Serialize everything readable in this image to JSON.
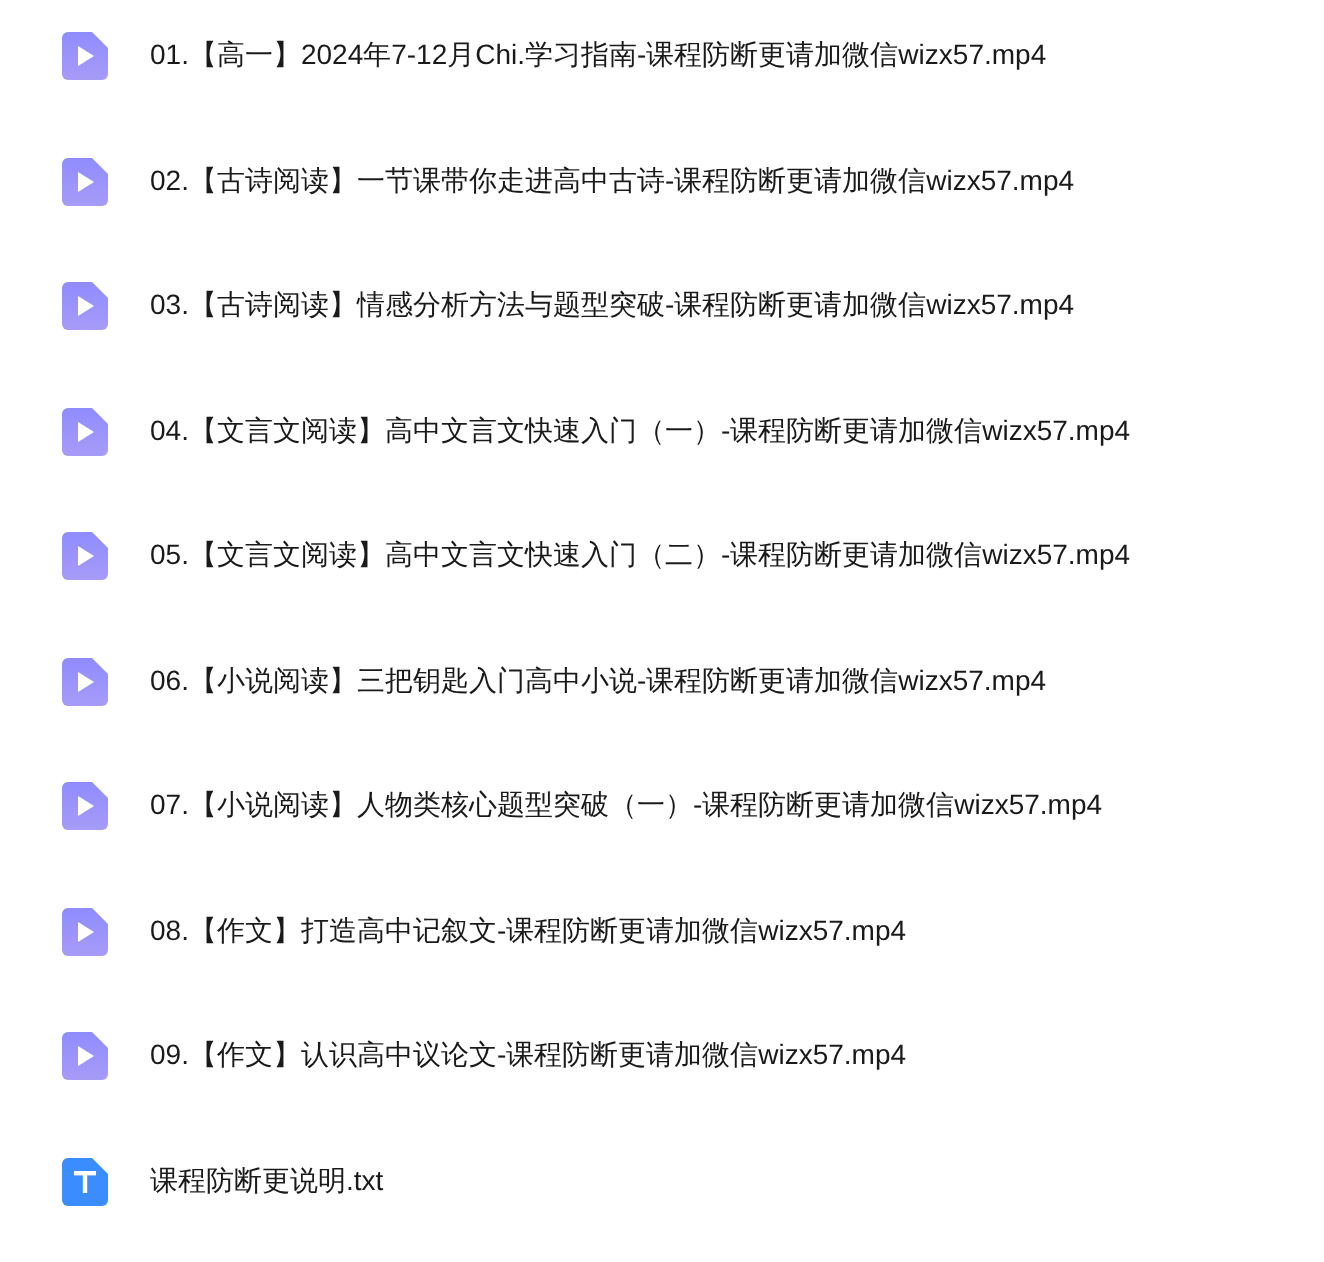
{
  "files": [
    {
      "name": "01.【高一】2024年7-12月Chi.学习指南-课程防断更请加微信wizx57.mp4",
      "kind": "video"
    },
    {
      "name": "02.【古诗阅读】一节课带你走进高中古诗-课程防断更请加微信wizx57.mp4",
      "kind": "video"
    },
    {
      "name": "03.【古诗阅读】情感分析方法与题型突破-课程防断更请加微信wizx57.mp4",
      "kind": "video"
    },
    {
      "name": "04.【文言文阅读】高中文言文快速入门（一）-课程防断更请加微信wizx57.mp4",
      "kind": "video"
    },
    {
      "name": "05.【文言文阅读】高中文言文快速入门（二）-课程防断更请加微信wizx57.mp4",
      "kind": "video"
    },
    {
      "name": "06.【小说阅读】三把钥匙入门高中小说-课程防断更请加微信wizx57.mp4",
      "kind": "video"
    },
    {
      "name": "07.【小说阅读】人物类核心题型突破（一）-课程防断更请加微信wizx57.mp4",
      "kind": "video"
    },
    {
      "name": "08.【作文】打造高中记叙文-课程防断更请加微信wizx57.mp4",
      "kind": "video"
    },
    {
      "name": "09.【作文】认识高中议论文-课程防断更请加微信wizx57.mp4",
      "kind": "video"
    },
    {
      "name": "课程防断更说明.txt",
      "kind": "text"
    }
  ]
}
